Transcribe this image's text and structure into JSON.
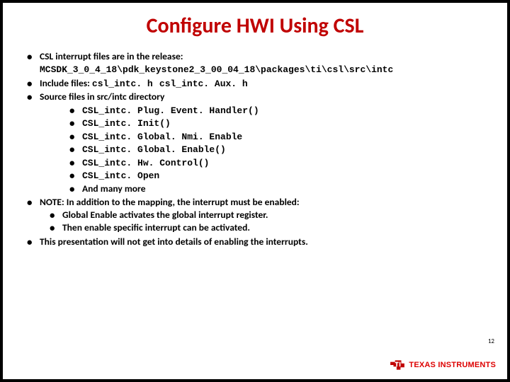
{
  "title": "Configure HWI Using CSL",
  "bullets": {
    "b1": "CSL interrupt files are in the release:",
    "b1path": "MCSDK_3_0_4_18\\pdk_keystone2_3_00_04_18\\packages\\ti\\csl\\src\\intc",
    "b2a": "Include files: ",
    "b2f1": "csl_intc. h",
    "b2f2": "csl_intc. Aux. h",
    "b3": "Source files in src/intc directory",
    "s1": "CSL_intc. Plug. Event. Handler()",
    "s2": "CSL_intc. Init()",
    "s3": "CSL_intc. Global. Nmi. Enable",
    "s4": "CSL_intc. Global. Enable()",
    "s5": "CSL_intc. Hw. Control()",
    "s6": "CSL_intc. Open",
    "s7": "And many more",
    "b4": "NOTE: In addition to the mapping, the interrupt must be enabled:",
    "b4s1": "Global Enable activates the global interrupt register.",
    "b4s2": "Then enable specific interrupt can be activated.",
    "b5": "This presentation will not get into details of enabling the interrupts."
  },
  "pageNumber": "12",
  "logo": {
    "company": "TEXAS INSTRUMENTS"
  }
}
